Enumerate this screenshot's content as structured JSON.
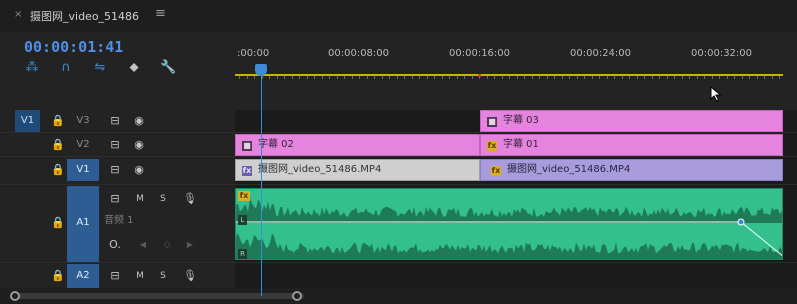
{
  "sequence": {
    "close_glyph": "×",
    "name": "摄图网_video_51486",
    "menu_glyph": "≡"
  },
  "timecode": "00:00:01:41",
  "tools": [
    {
      "name": "nest-snap-icon",
      "glyph": "⁂",
      "color": "#3d8ad9"
    },
    {
      "name": "snap-magnet-icon",
      "glyph": "∩",
      "color": "#3d8ad9"
    },
    {
      "name": "linked-selection-icon",
      "glyph": "⇋",
      "color": "#3d8ad9"
    },
    {
      "name": "add-marker-icon",
      "glyph": "⬥",
      "color": "#c4c4c4"
    },
    {
      "name": "wrench-icon",
      "glyph": "🔧",
      "color": "#c4c4c4"
    }
  ],
  "ruler": {
    "labels": [
      ":00:00",
      "00:00:08:00",
      "00:00:16:00",
      "00:00:24:00",
      "00:00:32:00"
    ]
  },
  "tracks": {
    "v3": {
      "source": "V1",
      "lock": "🔒",
      "label": "V3",
      "film": "⊟",
      "eye": "◉"
    },
    "v2": {
      "lock": "🔒",
      "label": "V2",
      "film": "⊟",
      "eye": "◉"
    },
    "v1": {
      "lock": "🔒",
      "label": "V1",
      "film": "⊟",
      "eye": "◉"
    },
    "a1": {
      "lock": "🔒",
      "label": "A1",
      "film": "⊟",
      "mute": "M",
      "solo": "S",
      "mic": "🎙",
      "name": "音频 1",
      "volume": "O.",
      "prev": "◀",
      "key": "◇",
      "next": "▶"
    },
    "a2": {
      "lock": "🔒",
      "label": "A2",
      "film": "⊟",
      "mute": "M",
      "solo": "S",
      "mic": "🎙"
    }
  },
  "clips": {
    "v3": [
      {
        "name": "字幕 03",
        "badge": "■"
      }
    ],
    "v2": [
      {
        "name": "字幕 02",
        "badge": "■"
      },
      {
        "name": "字幕 01",
        "badge": "fx"
      }
    ],
    "v1": [
      {
        "name": "摄图网_video_51486.MP4",
        "badge": "fx"
      },
      {
        "name": "摄图网_video_51486.MP4",
        "badge": "fx"
      }
    ],
    "a1": {
      "badge": "fx",
      "left_ch": "L",
      "right_ch": "R"
    }
  },
  "colors": {
    "accent": "#3d8ad9",
    "title_clip": "#e484de",
    "video_clip": "#a89cdc",
    "audio_clip": "#33c08e",
    "work_area": "#c7b400"
  }
}
